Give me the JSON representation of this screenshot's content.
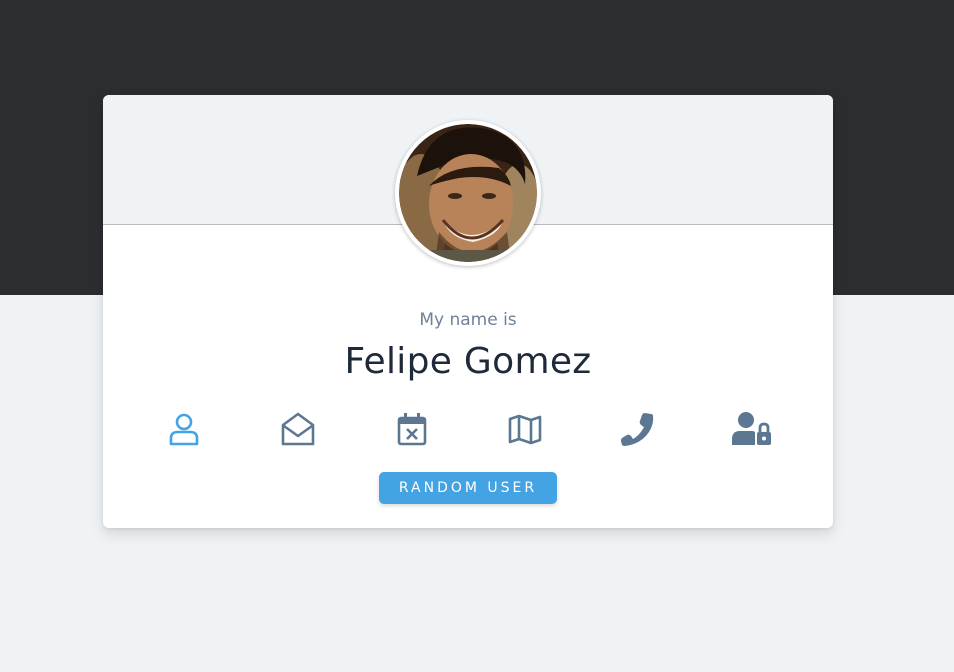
{
  "colors": {
    "top_background": "#2b2d31",
    "bottom_background": "#f0f3f6",
    "card_header_background": "#f0f3f6",
    "accent": "#44a3e3",
    "icon_inactive": "#5c7791"
  },
  "profile": {
    "subtitle": "My name is",
    "name": "Felipe Gomez",
    "avatar": "user-photo"
  },
  "info_icons": [
    {
      "icon": "user-icon",
      "active": true
    },
    {
      "icon": "envelope-open-icon",
      "active": false
    },
    {
      "icon": "calendar-icon",
      "active": false
    },
    {
      "icon": "map-icon",
      "active": false
    },
    {
      "icon": "phone-icon",
      "active": false
    },
    {
      "icon": "user-lock-icon",
      "active": false
    }
  ],
  "button": {
    "label": "RANDOM USER"
  }
}
